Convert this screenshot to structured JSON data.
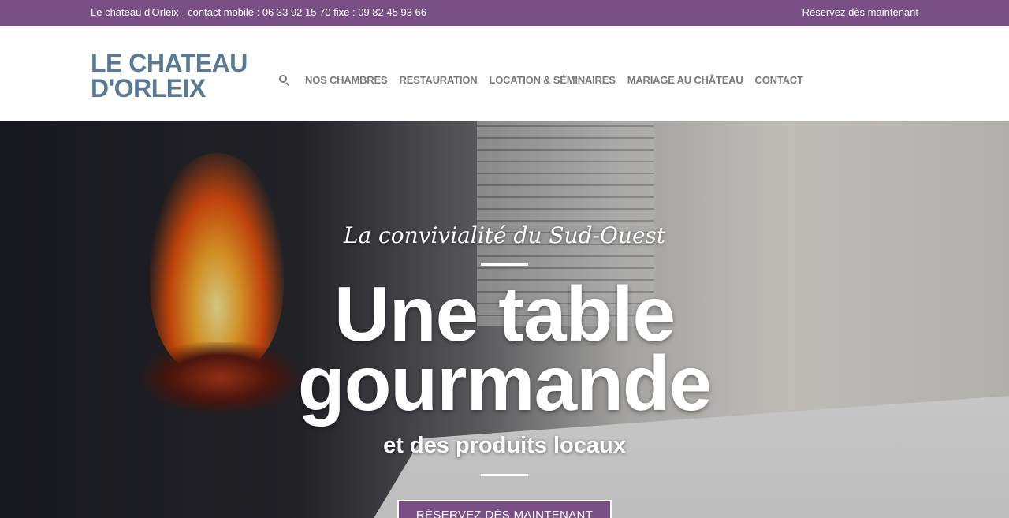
{
  "topbar": {
    "contact_text": "Le chateau d'Orleix - contact mobile : 06 33 92 15 70 fixe : 09 82 45 93 66",
    "reserve_link": "Réservez dès maintenant",
    "background_color": "#7a4f86"
  },
  "header": {
    "logo_line1": "LE CHATEAU",
    "logo_line2": "D'ORLEIX",
    "search_icon": "search-icon",
    "nav": [
      {
        "label": "NOS CHAMBRES"
      },
      {
        "label": "RESTAURATION"
      },
      {
        "label": "LOCATION & SÉMINAIRES"
      },
      {
        "label": "MARIAGE AU CHÂTEAU"
      },
      {
        "label": "CONTACT"
      }
    ]
  },
  "hero": {
    "tagline": "La convivialité du Sud-Ouest",
    "headline_line1": "Une table",
    "headline_line2": "gourmande",
    "subline": "et des produits locaux",
    "cta_label": "RÉSERVEZ DÈS MAINTENANT"
  }
}
